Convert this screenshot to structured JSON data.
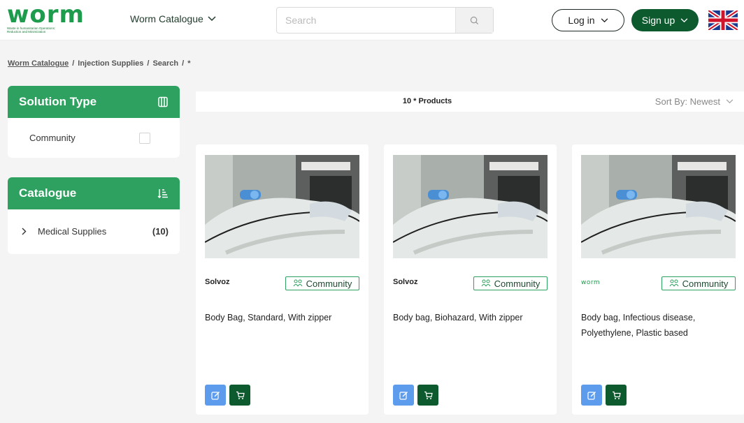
{
  "header": {
    "logo_text": "worm",
    "logo_tagline": "Waste in humanitarian Operations: Reduction and Minimization",
    "catalogue_menu_label": "Worm Catalogue",
    "search_placeholder": "Search",
    "login_label": "Log in",
    "signup_label": "Sign up",
    "language_icon": "uk-flag-icon"
  },
  "breadcrumb": {
    "items": [
      "Worm Catalogue",
      "Injection Supplies",
      "Search",
      "*"
    ],
    "separator": "/"
  },
  "filters": {
    "solution_type": {
      "title": "Solution Type",
      "icon": "book-icon",
      "options": [
        {
          "label": "Community",
          "checked": false
        }
      ]
    },
    "catalogue": {
      "title": "Catalogue",
      "icon": "sort-list-icon",
      "items": [
        {
          "label": "Medical Supplies",
          "count": "(10)"
        }
      ]
    }
  },
  "results": {
    "count_label": "10 * Products",
    "sort_label": "Sort By: Newest"
  },
  "products": [
    {
      "brand": "Solvoz",
      "badge": "Community",
      "name": "Body Bag, Standard, With zipper"
    },
    {
      "brand": "Solvoz",
      "badge": "Community",
      "name": "Body bag, Biohazard, With zipper"
    },
    {
      "brand": "worm",
      "badge": "Community",
      "name": "Body bag, Infectious disease, Polyethylene, Plastic based"
    }
  ],
  "colors": {
    "primary_green": "#2ea160",
    "dark_green": "#0d5a2e",
    "edit_blue": "#5d9cec",
    "brand_orange": "#e8711c"
  }
}
